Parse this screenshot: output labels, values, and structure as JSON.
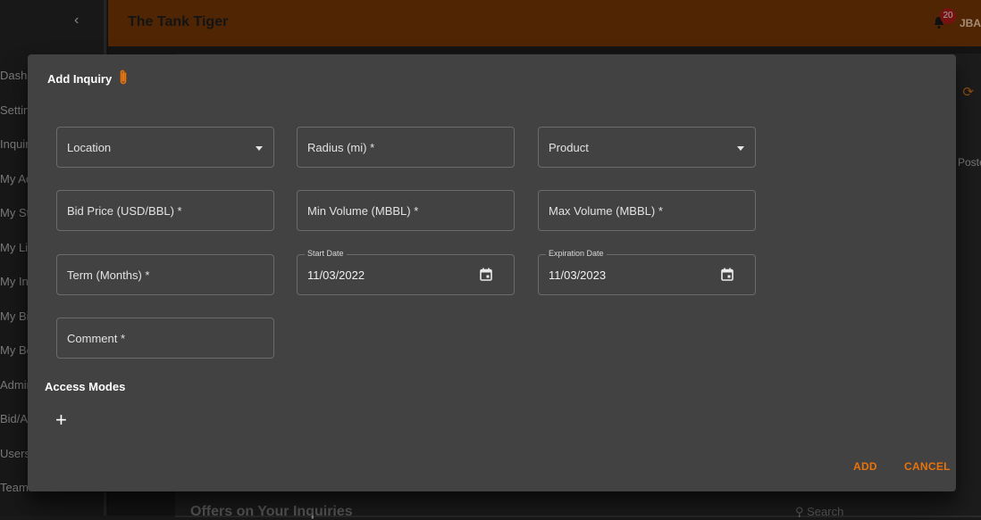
{
  "app": {
    "title": "The Tank Tiger",
    "notification_count": "20",
    "user_initials": "JBAI"
  },
  "sidebar": {
    "toggle_icon": "chevron-left-icon",
    "items": [
      {
        "label": "Dashboard"
      },
      {
        "label": "Settings"
      },
      {
        "label": "Inquiries"
      },
      {
        "label": "My Account"
      },
      {
        "label": "My Storage"
      },
      {
        "label": "My Listings"
      },
      {
        "label": "My Inquiries"
      },
      {
        "label": "My Bids"
      },
      {
        "label": "My Bookings"
      },
      {
        "label": "Admin"
      },
      {
        "label": "Bid/Ask"
      },
      {
        "label": "Users"
      },
      {
        "label": "Teams"
      }
    ]
  },
  "background": {
    "posted_label": "Posted",
    "offers_heading": "Offers on Your Inquiries",
    "search_placeholder": "Search"
  },
  "dialog": {
    "title": "Add Inquiry",
    "fields": {
      "location": {
        "label": "Location"
      },
      "radius": {
        "label": "Radius (mi) *"
      },
      "product": {
        "label": "Product"
      },
      "bid_price": {
        "label": "Bid Price (USD/BBL) *"
      },
      "min_volume": {
        "label": "Min Volume (MBBL) *"
      },
      "max_volume": {
        "label": "Max Volume (MBBL) *"
      },
      "term": {
        "label": "Term (Months) *"
      },
      "start_date": {
        "label": "Start Date",
        "value": "11/03/2022"
      },
      "expiration_date": {
        "label": "Expiration Date",
        "value": "11/03/2023"
      },
      "comment": {
        "label": "Comment *"
      }
    },
    "access_modes_label": "Access Modes",
    "add_mode_symbol": "+",
    "actions": {
      "add": "ADD",
      "cancel": "CANCEL"
    }
  },
  "colors": {
    "accent": "#e8730c",
    "topbar": "#7a3a06",
    "dialog_bg": "#424242"
  }
}
